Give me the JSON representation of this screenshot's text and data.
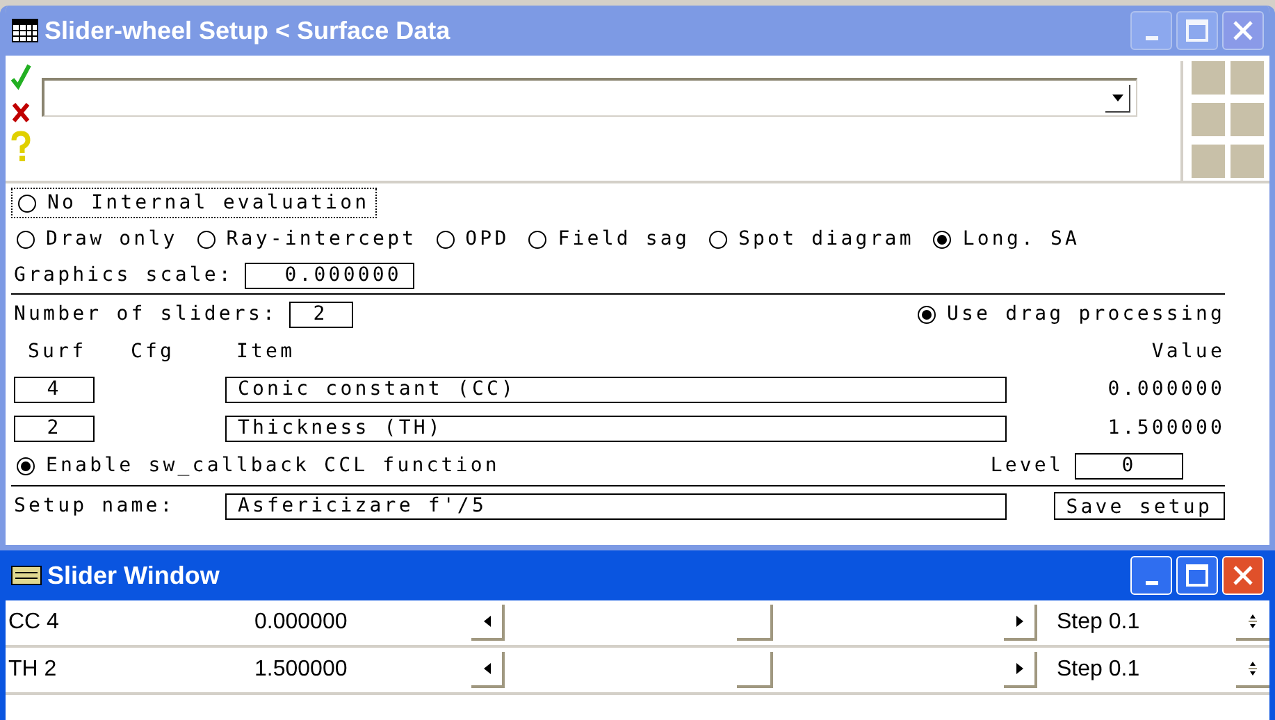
{
  "setup_window": {
    "title": "Slider-wheel Setup < Surface Data",
    "active": false
  },
  "evaluation_modes": [
    {
      "label": "No Internal evaluation",
      "selected": false
    },
    {
      "label": "Draw only",
      "selected": false
    },
    {
      "label": "Ray-intercept",
      "selected": false
    },
    {
      "label": "OPD",
      "selected": false
    },
    {
      "label": "Field sag",
      "selected": false
    },
    {
      "label": "Spot diagram",
      "selected": false
    },
    {
      "label": "Long. SA",
      "selected": true
    }
  ],
  "graphics_scale": {
    "label": "Graphics scale:",
    "value": "0.000000"
  },
  "number_of_sliders": {
    "label": "Number of sliders:",
    "value": "2"
  },
  "drag_processing": {
    "label": "Use drag processing",
    "selected": true
  },
  "columns": [
    "Surf",
    "Cfg",
    "Item",
    "Value"
  ],
  "sliders": [
    {
      "surf": "4",
      "item": "Conic constant (CC)",
      "value": "0.000000"
    },
    {
      "surf": "2",
      "item": "Thickness (TH)",
      "value": "1.500000"
    }
  ],
  "callback": {
    "label": "Enable sw_callback CCL function",
    "selected": true
  },
  "level": {
    "label": "Level",
    "value": "0"
  },
  "setup_name": {
    "label": "Setup name:",
    "value": "Asfericizare f'/5"
  },
  "save_button": "Save setup",
  "slider_window": {
    "title": "Slider Window",
    "active": true,
    "rows": [
      {
        "name": "CC 4",
        "value": "0.000000",
        "level": 0.5,
        "step": "Step 0.1"
      },
      {
        "name": "TH 2",
        "value": "1.500000",
        "level": 0.5,
        "step": "Step 0.1"
      }
    ]
  }
}
